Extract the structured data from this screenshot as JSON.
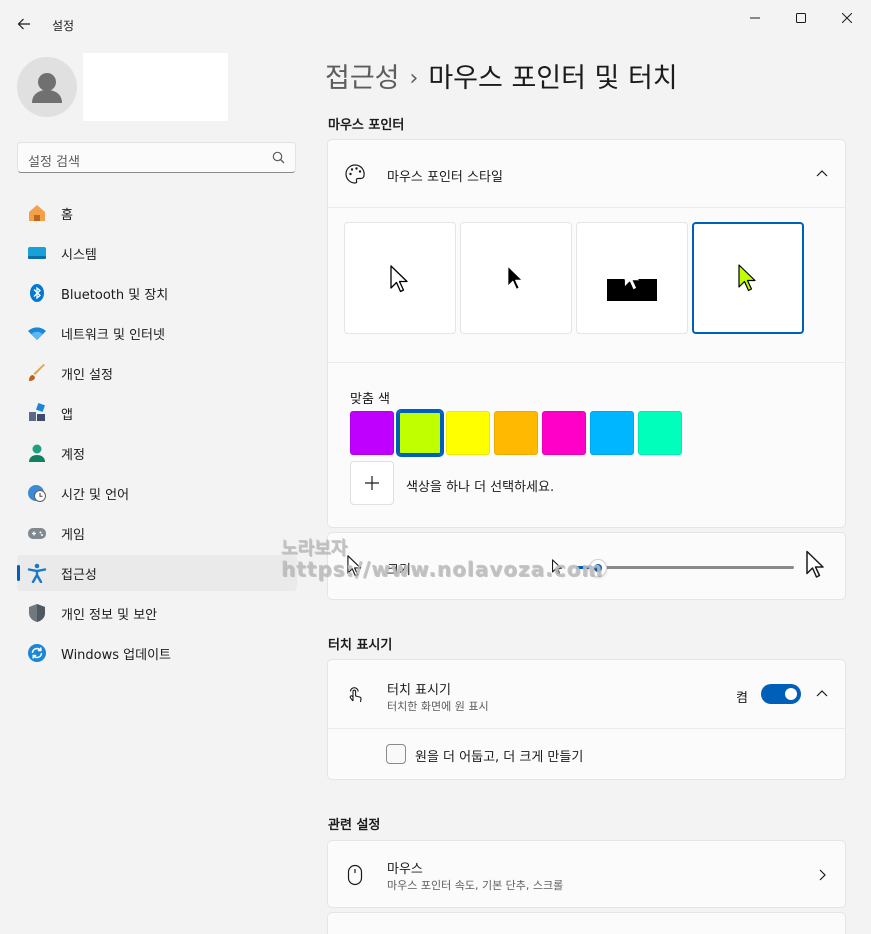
{
  "window": {
    "title": "설정",
    "back_icon": "arrow-left-icon",
    "controls": [
      "minimize-icon",
      "maximize-icon",
      "close-icon"
    ]
  },
  "search": {
    "placeholder": "설정 검색"
  },
  "sidebar": {
    "items": [
      {
        "label": "홈",
        "icon": "home-icon"
      },
      {
        "label": "시스템",
        "icon": "system-icon"
      },
      {
        "label": "Bluetooth 및 장치",
        "icon": "bluetooth-icon"
      },
      {
        "label": "네트워크 및 인터넷",
        "icon": "wifi-icon"
      },
      {
        "label": "개인 설정",
        "icon": "brush-icon"
      },
      {
        "label": "앱",
        "icon": "apps-icon"
      },
      {
        "label": "계정",
        "icon": "account-icon"
      },
      {
        "label": "시간 및 언어",
        "icon": "time-language-icon"
      },
      {
        "label": "게임",
        "icon": "gamepad-icon"
      },
      {
        "label": "접근성",
        "icon": "accessibility-icon",
        "active": true
      },
      {
        "label": "개인 정보 및 보안",
        "icon": "shield-icon"
      },
      {
        "label": "Windows 업데이트",
        "icon": "update-icon"
      }
    ]
  },
  "breadcrumb": {
    "parent": "접근성",
    "separator": "›",
    "current": "마우스 포인터 및 터치"
  },
  "mouse_pointer": {
    "section_title": "마우스 포인터",
    "style_label": "마우스 포인터 스타일",
    "style_options": [
      "white",
      "black",
      "inverted",
      "custom"
    ],
    "selected_style": "custom",
    "custom_color_label": "맞춤 색",
    "colors": [
      "#c000ff",
      "#bfff00",
      "#ffff00",
      "#ffb900",
      "#ff00c8",
      "#00b7ff",
      "#00ffbb"
    ],
    "selected_color": "#bfff00",
    "add_color_label": "색상을 하나 더 선택하세요.",
    "size_label": "크기",
    "size_value_fraction": 0.1
  },
  "touch": {
    "section_title": "터치 표시기",
    "indicator_label": "터치 표시기",
    "indicator_sub": "터치한 화면에 원 표시",
    "state_label": "켬",
    "checkbox_label": "원을 더 어둡고, 더 크게 만들기"
  },
  "related": {
    "section_title": "관련 설정",
    "mouse_label": "마우스",
    "mouse_sub": "마우스 포인터 속도, 기본 단추, 스크롤"
  },
  "watermark": {
    "line1": "노라보자",
    "line2": "https://www.nolavoza.com"
  },
  "colors": {
    "accent": "#005fb8",
    "background": "#f3f3f3",
    "card": "#fbfbfb"
  }
}
